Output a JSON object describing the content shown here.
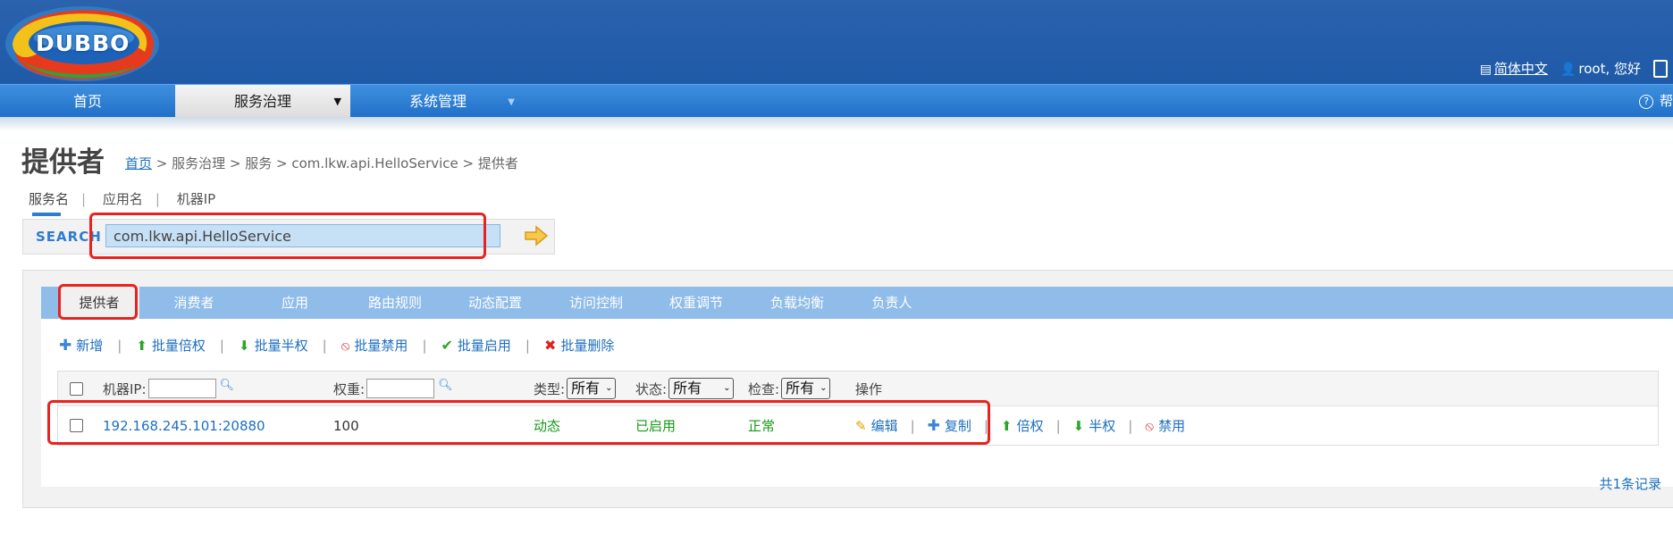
{
  "header": {
    "logo_text": "DUBBO",
    "language_label": "简体中文",
    "user_greeting": "root, 您好"
  },
  "nav": {
    "items": [
      {
        "label": "首页"
      },
      {
        "label": "服务治理"
      },
      {
        "label": "系统管理"
      }
    ],
    "help_label": "?"
  },
  "page": {
    "title": "提供者",
    "breadcrumb_home": "首页",
    "breadcrumb_rest": " > 服务治理 > 服务 > com.lkw.api.HelloService > 提供者"
  },
  "search": {
    "tabs": [
      "服务名",
      "应用名",
      "机器IP"
    ],
    "label": "SEARCH",
    "value": "com.lkw.api.HelloService"
  },
  "tabs": [
    "提供者",
    "消费者",
    "应用",
    "路由规则",
    "动态配置",
    "访问控制",
    "权重调节",
    "负载均衡",
    "负责人"
  ],
  "toolbar": {
    "add": "新增",
    "batch_double": "批量倍权",
    "batch_half": "批量半权",
    "batch_disable": "批量禁用",
    "batch_enable": "批量启用",
    "batch_delete": "批量删除"
  },
  "table": {
    "headers": {
      "ip": "机器IP:",
      "weight": "权重:",
      "type": "类型:",
      "status": "状态:",
      "check": "检查:",
      "actions": "操作"
    },
    "filters": {
      "type": "所有",
      "status": "所有",
      "check": "所有"
    },
    "rows": [
      {
        "ip": "192.168.245.101:20880",
        "weight": "100",
        "type": "动态",
        "status": "已启用",
        "check": "正常",
        "actions": {
          "edit": "编辑",
          "copy": "复制",
          "double": "倍权",
          "half": "半权",
          "disable": "禁用"
        }
      }
    ],
    "total": "共1条记录"
  },
  "colors": {
    "header_bg": "#1f5aa8",
    "nav_bg": "#2f7fd4",
    "tab_bar": "#8fbce8",
    "link": "#1d6fbf",
    "highlight": "#e8231f"
  }
}
